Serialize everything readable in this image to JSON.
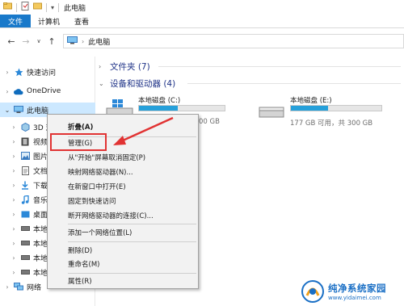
{
  "window": {
    "title": "此电脑"
  },
  "ribbon": {
    "tabs": [
      "文件",
      "计算机",
      "查看"
    ]
  },
  "address": {
    "path": "此电脑"
  },
  "nav": {
    "quick_access": "快速访问",
    "onedrive": "OneDrive",
    "this_pc": "此电脑",
    "sub_items": [
      "3D 对象",
      "视频",
      "图片",
      "文档",
      "下载",
      "音乐",
      "桌面",
      "本地",
      "本地",
      "本地",
      "本地"
    ],
    "network": "网络"
  },
  "content": {
    "folders_header": "文件夹 (7)",
    "drives_header": "设备和驱动器 (4)",
    "drives": [
      {
        "name": "本地磁盘 (C:)",
        "info": "00 GB",
        "used_fraction": 0.45
      },
      {
        "name": "本地磁盘 (E:)",
        "info": "177 GB 可用，共 300 GB",
        "used_fraction": 0.41
      }
    ]
  },
  "context_menu": {
    "items": [
      "折叠(A)",
      "管理(G)",
      "从\"开始\"屏幕取消固定(P)",
      "映射网络驱动器(N)...",
      "在新窗口中打开(E)",
      "固定到快速访问",
      "断开网络驱动器的连接(C)...",
      "添加一个网络位置(L)",
      "删除(D)",
      "重命名(M)",
      "属性(R)"
    ]
  },
  "watermark": {
    "name": "纯净系统家园",
    "url": "www.yidaimei.com"
  },
  "colors": {
    "accent": "#1979ca",
    "selection": "#cce8ff",
    "drive_fill": "#26a0da",
    "highlight": "#e13333"
  }
}
